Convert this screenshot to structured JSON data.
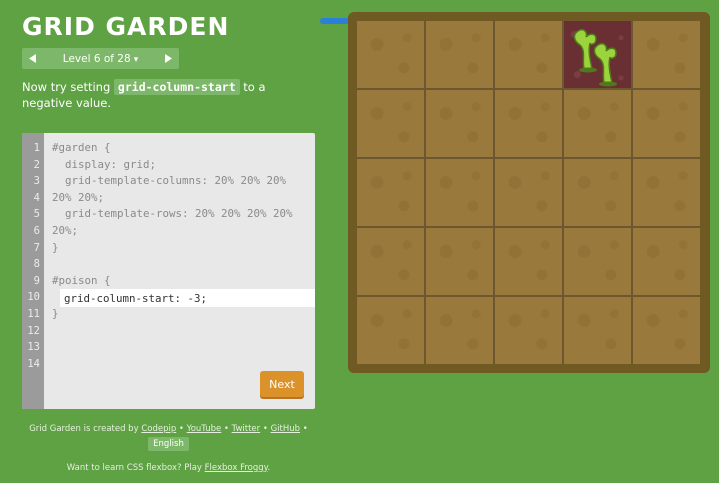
{
  "header": {
    "title": "GRID GARDEN"
  },
  "level_nav": {
    "prev_icon": "triangle-left-icon",
    "next_icon": "triangle-right-icon",
    "label": "Level 6 of 28",
    "caret": "▾"
  },
  "instruction": {
    "before": "Now try setting ",
    "code": "grid-column-start",
    "after": " to a negative value."
  },
  "editor": {
    "line_numbers": [
      "1",
      "2",
      "3",
      "4",
      "5",
      "6",
      "7",
      "8",
      "9",
      "10",
      "11",
      "12",
      "13",
      "14"
    ],
    "code_lines": [
      "#garden {",
      "  display: grid;",
      "  grid-template-columns: 20% 20% 20%",
      "20% 20%;",
      "  grid-template-rows: 20% 20% 20% 20%",
      "20%;",
      "}",
      "",
      "#poison {",
      "",
      "}"
    ],
    "input_value": "grid-column-start: -3;",
    "next_label": "Next"
  },
  "credits": {
    "prefix": "Grid Garden is created by ",
    "codepip": "Codepip",
    "sep1": " • ",
    "youtube": "YouTube",
    "sep2": " • ",
    "twitter": "Twitter",
    "sep3": " • ",
    "github": "GitHub",
    "sep4": " •",
    "language": "English"
  },
  "footer": {
    "text": "Want to learn CSS flexbox? Play ",
    "link": "Flexbox Froggy",
    "suffix": "."
  },
  "progress": {
    "value": 1.0
  },
  "garden": {
    "columns": 5,
    "rows": 5,
    "poison_column": 4,
    "poison_row": 1
  },
  "colors": {
    "background": "#5ea244",
    "soil": "#9a7a3c",
    "garden_border": "#6f5a23",
    "poison": "#6a2f33",
    "plant": "#9bd43c",
    "next_button": "#dc922b",
    "progress": "#2a7fd6"
  }
}
